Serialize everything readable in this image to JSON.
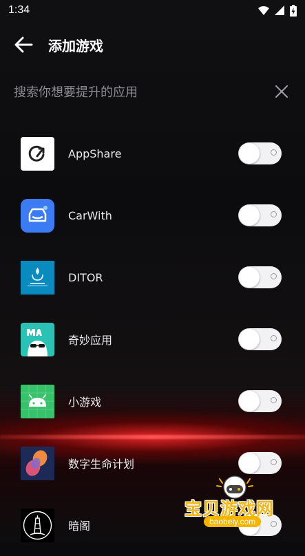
{
  "status": {
    "time": "1:34"
  },
  "header": {
    "title": "添加游戏"
  },
  "search": {
    "placeholder": "搜索你想要提升的应用"
  },
  "apps": [
    {
      "name": "AppShare",
      "icon": "appshare-icon",
      "enabled": false
    },
    {
      "name": "CarWith",
      "icon": "carwith-icon",
      "enabled": false
    },
    {
      "name": "DITOR",
      "icon": "ditor-icon",
      "enabled": false
    },
    {
      "name": "奇妙应用",
      "icon": "magic-icon",
      "enabled": false
    },
    {
      "name": "小游戏",
      "icon": "android-icon",
      "enabled": false
    },
    {
      "name": "数字生命计划",
      "icon": "digital-life-icon",
      "enabled": false
    },
    {
      "name": "暗阁",
      "icon": "lighthouse-icon",
      "enabled": false
    }
  ],
  "watermark": {
    "title": "宝贝游戏网",
    "url": "baobeiy.com"
  },
  "colors": {
    "accent": "#f3b81a",
    "toggle_track": "#f2f2f4",
    "placeholder": "#8c8c92"
  }
}
